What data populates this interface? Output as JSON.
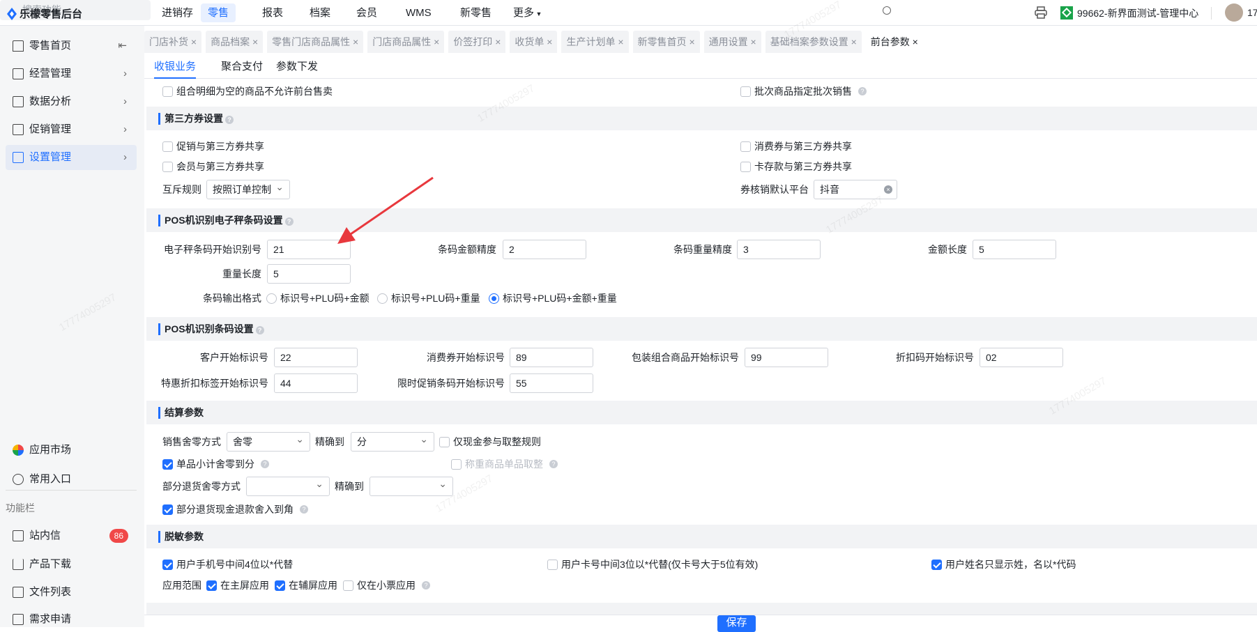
{
  "app": {
    "title": "乐檬零售后台"
  },
  "nav": [
    "进销存",
    "零售",
    "报表",
    "档案",
    "会员",
    "WMS",
    "新零售",
    "更多"
  ],
  "header": {
    "search_placeholder": "搜索功能",
    "store": "99662-新界面测试-管理中心",
    "user": "17"
  },
  "sidebar": {
    "items": [
      "零售首页",
      "经营管理",
      "数据分析",
      "促销管理",
      "设置管理"
    ],
    "bottom": [
      "应用市场",
      "常用入口"
    ],
    "section": "功能栏",
    "tools": [
      "站内信",
      "产品下载",
      "文件列表",
      "需求申请"
    ],
    "badge": "86"
  },
  "tabs": [
    "门店补货",
    "商品档案",
    "零售门店商品属性",
    "门店商品属性",
    "价签打印",
    "收货单",
    "生产计划单",
    "新零售首页",
    "通用设置",
    "基础档案参数设置",
    "前台参数"
  ],
  "subtabs": [
    "收银业务",
    "聚合支付",
    "参数下发"
  ],
  "top_row": {
    "combo_empty": "组合明细为空的商品不允许前台售卖",
    "batch": "批次商品指定批次销售"
  },
  "third_party": {
    "title": "第三方券设置",
    "promo": "促销与第三方券共享",
    "consume": "消费券与第三方券共享",
    "member": "会员与第三方券共享",
    "card": "卡存款与第三方券共享",
    "mutex_label": "互斥规则",
    "mutex_value": "按照订单控制",
    "platform_label": "券核销默认平台",
    "platform_value": "抖音"
  },
  "scale": {
    "title": "POS机识别电子秤条码设置",
    "start_label": "电子秤条码开始识别号",
    "start": "21",
    "amount_prec_label": "条码金额精度",
    "amount_prec": "2",
    "weight_prec_label": "条码重量精度",
    "weight_prec": "3",
    "amount_len_label": "金额长度",
    "amount_len": "5",
    "weight_len_label": "重量长度",
    "weight_len": "5",
    "format_label": "条码输出格式",
    "formats": [
      "标识号+PLU码+金额",
      "标识号+PLU码+重量",
      "标识号+PLU码+金额+重量"
    ],
    "format_selected": 2
  },
  "barcode": {
    "title": "POS机识别条码设置",
    "customer_label": "客户开始标识号",
    "customer": "22",
    "coupon_label": "消费券开始标识号",
    "coupon": "89",
    "pack_label": "包装组合商品开始标识号",
    "pack": "99",
    "discount_label": "折扣码开始标识号",
    "discount": "02",
    "special_label": "特惠折扣标签开始标识号",
    "special": "44",
    "limited_label": "限时促销条码开始标识号",
    "limited": "55"
  },
  "settle": {
    "title": "结算参数",
    "round_label": "销售舍零方式",
    "round_value": "舍零",
    "precise_label": "精确到",
    "precise_value": "分",
    "cash_only": "仅现金参与取整规则",
    "item_round": "单品小计舍零到分",
    "weighed_round": "称重商品单品取整",
    "return_round_label": "部分退货舍零方式",
    "return_round_value": "",
    "return_precise_label": "精确到",
    "return_precise_value": "",
    "return_cash": "部分退货现金退款舍入到角"
  },
  "mask": {
    "title": "脱敏参数",
    "phone": "用户手机号中间4位以*代替",
    "card": "用户卡号中间3位以*代替(仅卡号大于5位有效)",
    "name": "用户姓名只显示姓，名以*代码",
    "scope_label": "应用范围",
    "main": "在主屏应用",
    "sub": "在辅屏应用",
    "ticket": "仅在小票应用"
  },
  "footer": {
    "save": "保存"
  },
  "watermark": "17774005297",
  "colors": {
    "accent": "#1f6fff",
    "badge": "#f04848",
    "arrow": "#e8383d"
  }
}
